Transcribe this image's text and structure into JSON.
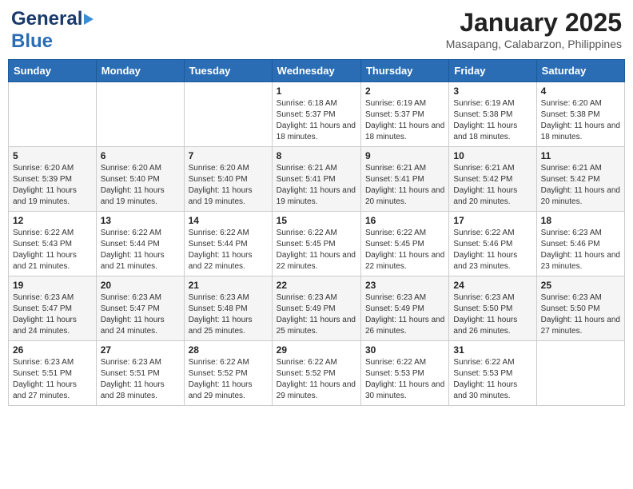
{
  "header": {
    "logo_general": "General",
    "logo_blue": "Blue",
    "month_title": "January 2025",
    "location": "Masapang, Calabarzon, Philippines"
  },
  "days_of_week": [
    "Sunday",
    "Monday",
    "Tuesday",
    "Wednesday",
    "Thursday",
    "Friday",
    "Saturday"
  ],
  "weeks": [
    [
      {
        "day": "",
        "sunrise": "",
        "sunset": "",
        "daylight": ""
      },
      {
        "day": "",
        "sunrise": "",
        "sunset": "",
        "daylight": ""
      },
      {
        "day": "",
        "sunrise": "",
        "sunset": "",
        "daylight": ""
      },
      {
        "day": "1",
        "sunrise": "Sunrise: 6:18 AM",
        "sunset": "Sunset: 5:37 PM",
        "daylight": "Daylight: 11 hours and 18 minutes."
      },
      {
        "day": "2",
        "sunrise": "Sunrise: 6:19 AM",
        "sunset": "Sunset: 5:37 PM",
        "daylight": "Daylight: 11 hours and 18 minutes."
      },
      {
        "day": "3",
        "sunrise": "Sunrise: 6:19 AM",
        "sunset": "Sunset: 5:38 PM",
        "daylight": "Daylight: 11 hours and 18 minutes."
      },
      {
        "day": "4",
        "sunrise": "Sunrise: 6:20 AM",
        "sunset": "Sunset: 5:38 PM",
        "daylight": "Daylight: 11 hours and 18 minutes."
      }
    ],
    [
      {
        "day": "5",
        "sunrise": "Sunrise: 6:20 AM",
        "sunset": "Sunset: 5:39 PM",
        "daylight": "Daylight: 11 hours and 19 minutes."
      },
      {
        "day": "6",
        "sunrise": "Sunrise: 6:20 AM",
        "sunset": "Sunset: 5:40 PM",
        "daylight": "Daylight: 11 hours and 19 minutes."
      },
      {
        "day": "7",
        "sunrise": "Sunrise: 6:20 AM",
        "sunset": "Sunset: 5:40 PM",
        "daylight": "Daylight: 11 hours and 19 minutes."
      },
      {
        "day": "8",
        "sunrise": "Sunrise: 6:21 AM",
        "sunset": "Sunset: 5:41 PM",
        "daylight": "Daylight: 11 hours and 19 minutes."
      },
      {
        "day": "9",
        "sunrise": "Sunrise: 6:21 AM",
        "sunset": "Sunset: 5:41 PM",
        "daylight": "Daylight: 11 hours and 20 minutes."
      },
      {
        "day": "10",
        "sunrise": "Sunrise: 6:21 AM",
        "sunset": "Sunset: 5:42 PM",
        "daylight": "Daylight: 11 hours and 20 minutes."
      },
      {
        "day": "11",
        "sunrise": "Sunrise: 6:21 AM",
        "sunset": "Sunset: 5:42 PM",
        "daylight": "Daylight: 11 hours and 20 minutes."
      }
    ],
    [
      {
        "day": "12",
        "sunrise": "Sunrise: 6:22 AM",
        "sunset": "Sunset: 5:43 PM",
        "daylight": "Daylight: 11 hours and 21 minutes."
      },
      {
        "day": "13",
        "sunrise": "Sunrise: 6:22 AM",
        "sunset": "Sunset: 5:44 PM",
        "daylight": "Daylight: 11 hours and 21 minutes."
      },
      {
        "day": "14",
        "sunrise": "Sunrise: 6:22 AM",
        "sunset": "Sunset: 5:44 PM",
        "daylight": "Daylight: 11 hours and 22 minutes."
      },
      {
        "day": "15",
        "sunrise": "Sunrise: 6:22 AM",
        "sunset": "Sunset: 5:45 PM",
        "daylight": "Daylight: 11 hours and 22 minutes."
      },
      {
        "day": "16",
        "sunrise": "Sunrise: 6:22 AM",
        "sunset": "Sunset: 5:45 PM",
        "daylight": "Daylight: 11 hours and 22 minutes."
      },
      {
        "day": "17",
        "sunrise": "Sunrise: 6:22 AM",
        "sunset": "Sunset: 5:46 PM",
        "daylight": "Daylight: 11 hours and 23 minutes."
      },
      {
        "day": "18",
        "sunrise": "Sunrise: 6:23 AM",
        "sunset": "Sunset: 5:46 PM",
        "daylight": "Daylight: 11 hours and 23 minutes."
      }
    ],
    [
      {
        "day": "19",
        "sunrise": "Sunrise: 6:23 AM",
        "sunset": "Sunset: 5:47 PM",
        "daylight": "Daylight: 11 hours and 24 minutes."
      },
      {
        "day": "20",
        "sunrise": "Sunrise: 6:23 AM",
        "sunset": "Sunset: 5:47 PM",
        "daylight": "Daylight: 11 hours and 24 minutes."
      },
      {
        "day": "21",
        "sunrise": "Sunrise: 6:23 AM",
        "sunset": "Sunset: 5:48 PM",
        "daylight": "Daylight: 11 hours and 25 minutes."
      },
      {
        "day": "22",
        "sunrise": "Sunrise: 6:23 AM",
        "sunset": "Sunset: 5:49 PM",
        "daylight": "Daylight: 11 hours and 25 minutes."
      },
      {
        "day": "23",
        "sunrise": "Sunrise: 6:23 AM",
        "sunset": "Sunset: 5:49 PM",
        "daylight": "Daylight: 11 hours and 26 minutes."
      },
      {
        "day": "24",
        "sunrise": "Sunrise: 6:23 AM",
        "sunset": "Sunset: 5:50 PM",
        "daylight": "Daylight: 11 hours and 26 minutes."
      },
      {
        "day": "25",
        "sunrise": "Sunrise: 6:23 AM",
        "sunset": "Sunset: 5:50 PM",
        "daylight": "Daylight: 11 hours and 27 minutes."
      }
    ],
    [
      {
        "day": "26",
        "sunrise": "Sunrise: 6:23 AM",
        "sunset": "Sunset: 5:51 PM",
        "daylight": "Daylight: 11 hours and 27 minutes."
      },
      {
        "day": "27",
        "sunrise": "Sunrise: 6:23 AM",
        "sunset": "Sunset: 5:51 PM",
        "daylight": "Daylight: 11 hours and 28 minutes."
      },
      {
        "day": "28",
        "sunrise": "Sunrise: 6:22 AM",
        "sunset": "Sunset: 5:52 PM",
        "daylight": "Daylight: 11 hours and 29 minutes."
      },
      {
        "day": "29",
        "sunrise": "Sunrise: 6:22 AM",
        "sunset": "Sunset: 5:52 PM",
        "daylight": "Daylight: 11 hours and 29 minutes."
      },
      {
        "day": "30",
        "sunrise": "Sunrise: 6:22 AM",
        "sunset": "Sunset: 5:53 PM",
        "daylight": "Daylight: 11 hours and 30 minutes."
      },
      {
        "day": "31",
        "sunrise": "Sunrise: 6:22 AM",
        "sunset": "Sunset: 5:53 PM",
        "daylight": "Daylight: 11 hours and 30 minutes."
      },
      {
        "day": "",
        "sunrise": "",
        "sunset": "",
        "daylight": ""
      }
    ]
  ]
}
